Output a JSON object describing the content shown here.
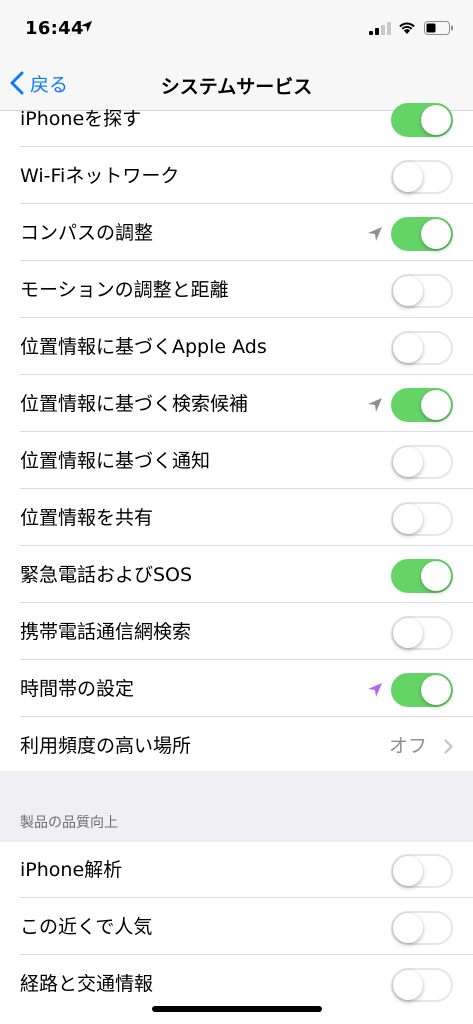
{
  "status_bar": {
    "time": "16:44"
  },
  "nav": {
    "back_label": "戻る",
    "title": "システムサービス"
  },
  "system_services": [
    {
      "label": "iPhoneを探す",
      "on": true,
      "location_icon": "none"
    },
    {
      "label": "Wi-Fiネットワーク",
      "on": false,
      "location_icon": "none"
    },
    {
      "label": "コンパスの調整",
      "on": true,
      "location_icon": "gray"
    },
    {
      "label": "モーションの調整と距離",
      "on": false,
      "location_icon": "none"
    },
    {
      "label": "位置情報に基づくApple Ads",
      "on": false,
      "location_icon": "none"
    },
    {
      "label": "位置情報に基づく検索候補",
      "on": true,
      "location_icon": "gray"
    },
    {
      "label": "位置情報に基づく通知",
      "on": false,
      "location_icon": "none"
    },
    {
      "label": "位置情報を共有",
      "on": false,
      "location_icon": "none"
    },
    {
      "label": "緊急電話およびSOS",
      "on": true,
      "location_icon": "none"
    },
    {
      "label": "携帯電話通信網検索",
      "on": false,
      "location_icon": "none"
    },
    {
      "label": "時間帯の設定",
      "on": true,
      "location_icon": "purple"
    }
  ],
  "frequent_locations": {
    "label": "利用頻度の高い場所",
    "value": "オフ"
  },
  "product_section": {
    "header": "製品の品質向上",
    "items": [
      {
        "label": "iPhone解析",
        "on": false
      },
      {
        "label": "この近くで人気",
        "on": false
      },
      {
        "label": "経路と交通情報",
        "on": false
      }
    ]
  },
  "colors": {
    "accent": "#0a7aff",
    "toggle_on": "#65d467",
    "location_gray": "#8e8e93",
    "location_purple": "#b266f2"
  }
}
